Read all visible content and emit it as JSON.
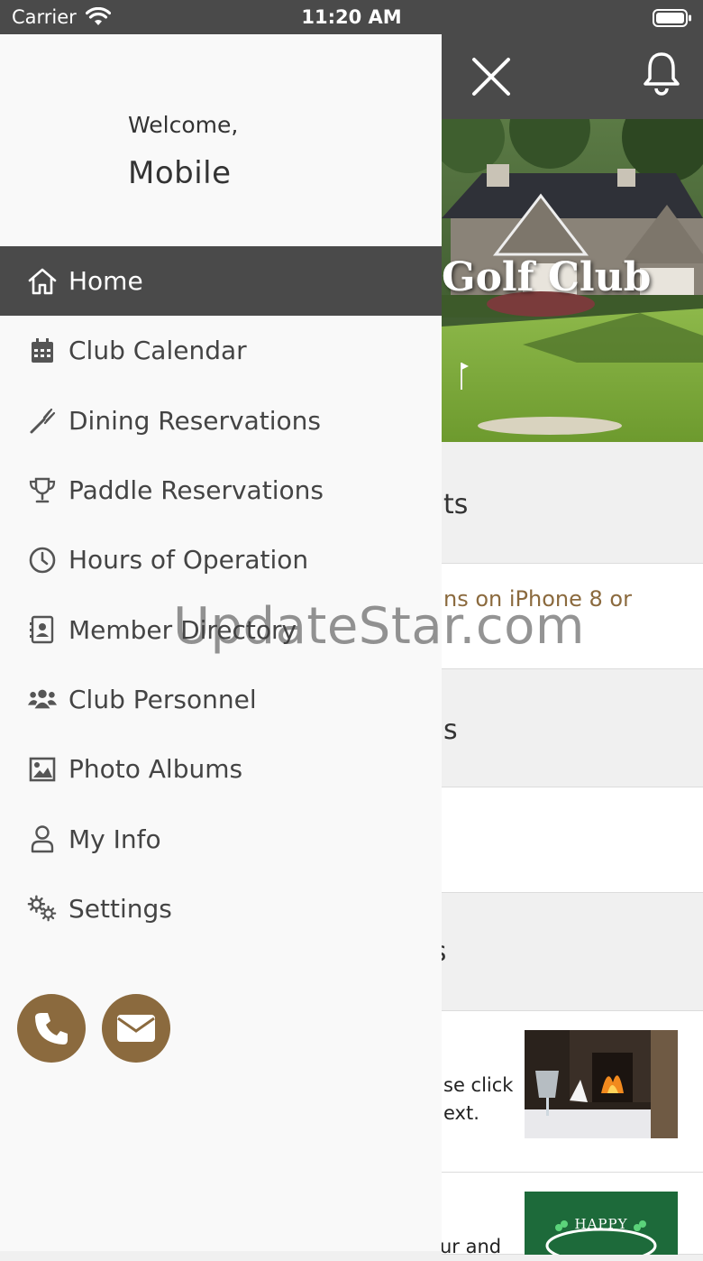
{
  "status_bar": {
    "carrier": "Carrier",
    "time": "11:20 AM"
  },
  "drawer": {
    "welcome": "Welcome,",
    "user_name": "Mobile",
    "menu": [
      {
        "label": "Home",
        "icon": "home-icon",
        "active": true
      },
      {
        "label": "Club Calendar",
        "icon": "calendar-icon"
      },
      {
        "label": "Dining Reservations",
        "icon": "utensils-icon"
      },
      {
        "label": "Paddle Reservations",
        "icon": "trophy-icon"
      },
      {
        "label": "Hours of Operation",
        "icon": "clock-icon"
      },
      {
        "label": "Member Directory",
        "icon": "contact-card-icon"
      },
      {
        "label": "Club Personnel",
        "icon": "people-icon"
      },
      {
        "label": "Photo Albums",
        "icon": "image-icon"
      },
      {
        "label": "My Info",
        "icon": "user-icon"
      },
      {
        "label": "Settings",
        "icon": "gears-icon"
      }
    ],
    "contact_buttons": [
      {
        "icon": "phone-icon"
      },
      {
        "icon": "envelope-icon"
      }
    ]
  },
  "background": {
    "hero_title": "Golf Club",
    "sections": [
      {
        "title": "ts"
      },
      {
        "link": "ns on iPhone 8 or"
      },
      {
        "title": "s"
      },
      {
        "title": "ts"
      },
      {
        "text_line1": "se click",
        "text_line2": "ext."
      },
      {
        "text_line1": "ur and"
      }
    ],
    "thumb2_text": "HAPPY"
  },
  "watermark": "UpdateStar.com",
  "colors": {
    "accent": "#8b6a3e",
    "header": "#4a4a4a",
    "drawer": "#f9f9f9"
  }
}
